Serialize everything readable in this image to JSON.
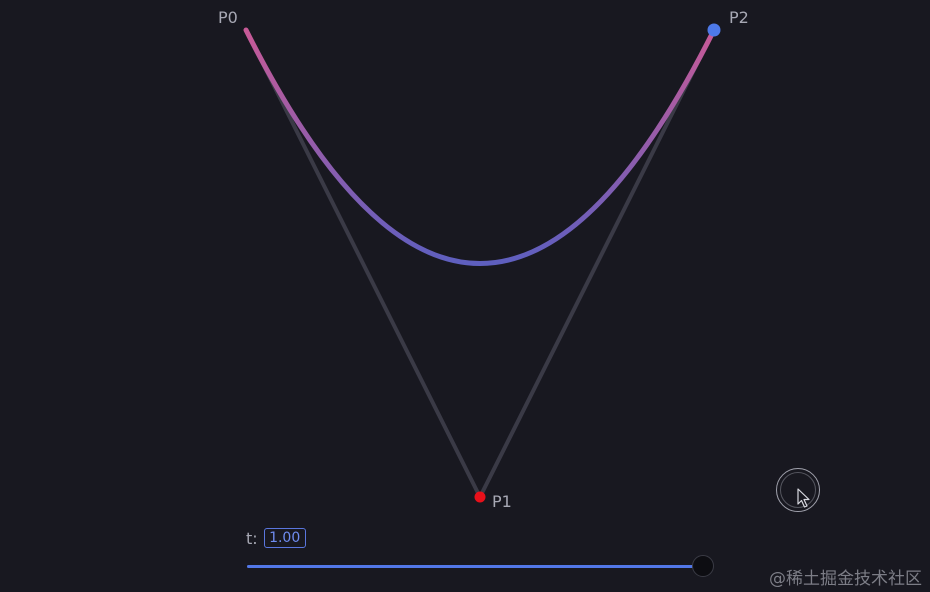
{
  "points": {
    "p0": {
      "label": "P0",
      "color": "#c25a9a"
    },
    "p1": {
      "label": "P1",
      "color": "#e8101a"
    },
    "p2": {
      "label": "P2",
      "color": "#4d79e8"
    }
  },
  "curve": {
    "start_color": "#c75a97",
    "mid_color": "#5e5fbf"
  },
  "control_line_color": "#3a3a46",
  "t_control": {
    "label": "t:",
    "value": "1.00",
    "fraction": 1.0
  },
  "watermark": "@稀土掘金技术社区"
}
